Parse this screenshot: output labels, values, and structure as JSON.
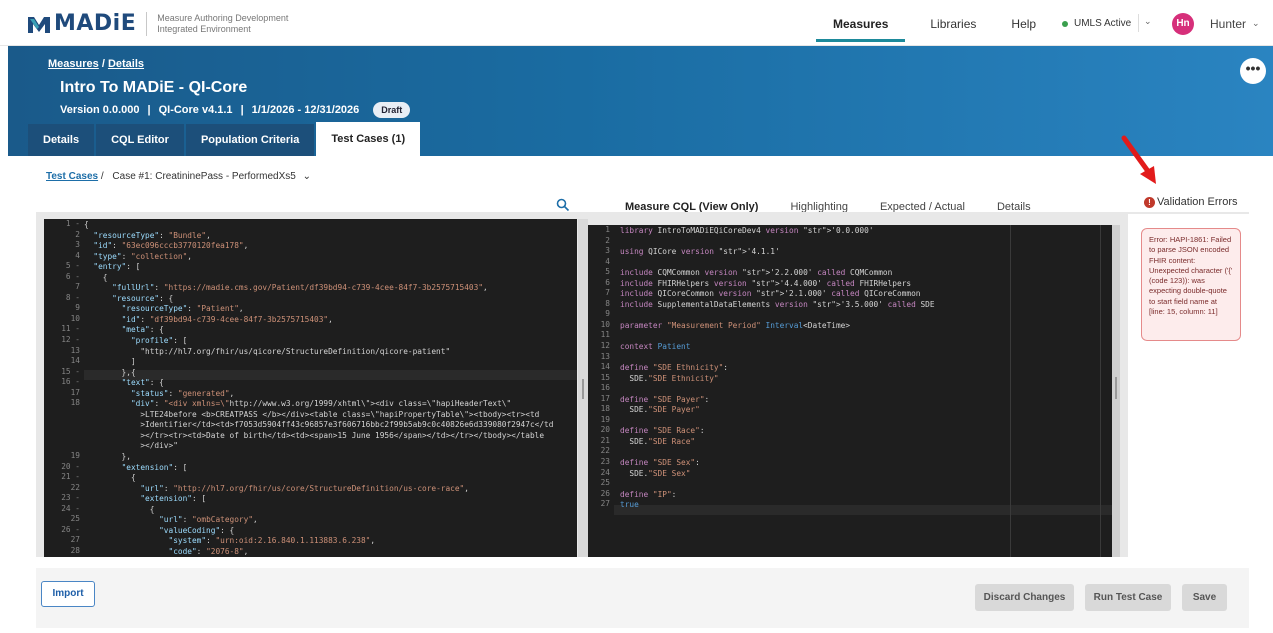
{
  "app": {
    "logo_text": "MADiE",
    "logo_sub_line1": "Measure Authoring Development",
    "logo_sub_line2": "Integrated Environment"
  },
  "nav": {
    "items": [
      {
        "label": "Measures",
        "active": true
      },
      {
        "label": "Libraries",
        "active": false
      },
      {
        "label": "Help",
        "active": false
      }
    ],
    "umls_status": "UMLS Active",
    "avatar_initials": "Hn",
    "user_name": "Hunter"
  },
  "header": {
    "crumb_measures": "Measures",
    "crumb_sep": "/",
    "crumb_details": "Details",
    "title": "Intro To MADiE - QI-Core",
    "version": "Version 0.0.000",
    "model": "QI-Core v4.1.1",
    "period": "1/1/2026 - 12/31/2026",
    "status_badge": "Draft",
    "more_label": "•••"
  },
  "tabs": [
    {
      "label": "Details",
      "active": false
    },
    {
      "label": "CQL Editor",
      "active": false
    },
    {
      "label": "Population Criteria",
      "active": false
    },
    {
      "label": "Test Cases (1)",
      "active": true
    }
  ],
  "subcrumb": {
    "link": "Test Cases",
    "sep": "/",
    "current": "Case #1: CreatininePass - PerformedXs5",
    "chevron": "⌄"
  },
  "right_tabs": [
    {
      "label": "Measure CQL (View Only)",
      "active": true
    },
    {
      "label": "Highlighting",
      "active": false
    },
    {
      "label": "Expected / Actual",
      "active": false
    },
    {
      "label": "Details",
      "active": false
    }
  ],
  "validation": {
    "title": "Validation Errors",
    "error_text": "Error: HAPI-1861: Failed to parse JSON encoded FHIR content: Unexpected character ('{' (code 123)): was expecting double-quote to start field name at [line: 15, column: 11]"
  },
  "json_editor": {
    "line_numbers": [
      "1 -",
      "2",
      "3",
      "4",
      "5 -",
      "6 -",
      "7",
      "8 -",
      "9",
      "10",
      "11 -",
      "12 -",
      "13",
      "14",
      "15 -",
      "16 -",
      "17",
      "18",
      "",
      "",
      "",
      "",
      "19",
      "20 -",
      "21 -",
      "22",
      "23 -",
      "24 -",
      "25",
      "26 -",
      "27",
      "28"
    ],
    "lines": [
      "{",
      "  \"resourceType\": \"Bundle\",",
      "  \"id\": \"63ec096cccb3770120fea178\",",
      "  \"type\": \"collection\",",
      "  \"entry\": [",
      "    {",
      "      \"fullUrl\": \"https://madie.cms.gov/Patient/df39bd94-c739-4cee-84f7-3b2575715403\",",
      "      \"resource\": {",
      "        \"resourceType\": \"Patient\",",
      "        \"id\": \"df39bd94-c739-4cee-84f7-3b2575715403\",",
      "        \"meta\": {",
      "          \"profile\": [",
      "            \"http://hl7.org/fhir/us/qicore/StructureDefinition/qicore-patient\"",
      "          ]",
      "        },{",
      "        \"text\": {",
      "          \"status\": \"generated\",",
      "          \"div\": \"<div xmlns=\\\"http://www.w3.org/1999/xhtml\\\"><div class=\\\"hapiHeaderText\\\"",
      "            >LTE24before <b>CREATPASS </b></div><table class=\\\"hapiPropertyTable\\\"><tbody><tr><td",
      "            >Identifier</td><td>f7053d5904ff43c96857e3f606716bbc2f99b5ab9c0c40826e6d339080f2947c</td",
      "            ></tr><tr><td>Date of birth</td><td><span>15 June 1956</span></td></tr></tbody></table",
      "            ></div>\"",
      "        },",
      "        \"extension\": [",
      "          {",
      "            \"url\": \"http://hl7.org/fhir/us/core/StructureDefinition/us-core-race\",",
      "            \"extension\": [",
      "              {",
      "                \"url\": \"ombCategory\",",
      "                \"valueCoding\": {",
      "                  \"system\": \"urn:oid:2.16.840.1.113883.6.238\",",
      "                  \"code\": \"2076-8\","
    ]
  },
  "cql_editor": {
    "line_numbers": [
      "1",
      "2",
      "3",
      "4",
      "5",
      "6",
      "7",
      "8",
      "9",
      "10",
      "11",
      "12",
      "13",
      "14",
      "15",
      "16",
      "17",
      "18",
      "19",
      "20",
      "21",
      "22",
      "23",
      "24",
      "25",
      "26",
      "27"
    ],
    "lines": [
      "library IntroToMADiEQiCoreDev4 version '0.0.000'",
      "",
      "using QICore version '4.1.1'",
      "",
      "include CQMCommon version '2.2.000' called CQMCommon",
      "include FHIRHelpers version '4.4.000' called FHIRHelpers",
      "include QICoreCommon version '2.1.000' called QICoreCommon",
      "include SupplementalDataElements version '3.5.000' called SDE",
      "",
      "parameter \"Measurement Period\" Interval<DateTime>",
      "",
      "context Patient",
      "",
      "define \"SDE Ethnicity\":",
      "  SDE.\"SDE Ethnicity\"",
      "",
      "define \"SDE Payer\":",
      "  SDE.\"SDE Payer\"",
      "",
      "define \"SDE Race\":",
      "  SDE.\"SDE Race\"",
      "",
      "define \"SDE Sex\":",
      "  SDE.\"SDE Sex\"",
      "",
      "define \"IP\":",
      "true"
    ]
  },
  "footer": {
    "import_label": "Import",
    "discard_label": "Discard Changes",
    "run_label": "Run Test Case",
    "save_label": "Save"
  },
  "colors": {
    "accent_teal": "#1d8a9b",
    "header_blue": "#1a6ca2",
    "error_red": "#c0392b"
  }
}
